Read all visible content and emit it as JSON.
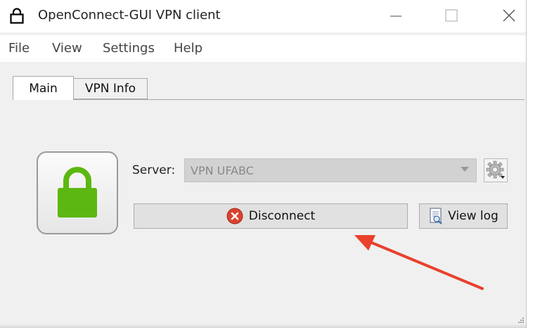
{
  "window": {
    "title": "OpenConnect-GUI VPN client",
    "icon": "lock-outline-icon",
    "controls": [
      "minimize-icon",
      "maximize-icon",
      "close-icon"
    ]
  },
  "menu": {
    "items": [
      "File",
      "View",
      "Settings",
      "Help"
    ]
  },
  "tabs": [
    {
      "label": "Main",
      "active": true
    },
    {
      "label": "VPN Info",
      "active": false
    }
  ],
  "main": {
    "status_icon": "lock-closed-icon",
    "status_color": "#5cb811",
    "server_label": "Server:",
    "server_value": "VPN UFABC",
    "server_enabled": false,
    "settings_icon": "gear-icon",
    "disconnect": {
      "label": "Disconnect",
      "icon": "error-x-icon",
      "icon_color": "#d9432f"
    },
    "view_log": {
      "label": "View log",
      "icon": "log-document-icon"
    }
  },
  "annotation": {
    "arrow_color": "#e8412c"
  }
}
